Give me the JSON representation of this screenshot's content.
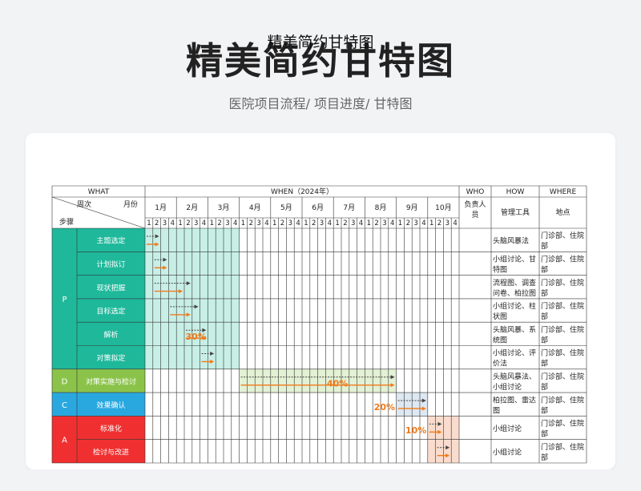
{
  "page": {
    "title": "精美简约甘特图",
    "breadcrumb": "医院项目流程/  项目进度/  甘特图"
  },
  "sheet": {
    "title": "精美简约甘特图",
    "header": {
      "what": "WHAT",
      "when": "WHEN（2024年）",
      "who": "WHO",
      "how": "HOW",
      "where": "WHERE",
      "zhouci": "周次",
      "yuefen": "月份",
      "buzhou": "步骤",
      "responsible": "负责人员",
      "tool": "管理工具",
      "location": "地点"
    },
    "months": [
      "1月",
      "2月",
      "3月",
      "4月",
      "5月",
      "6月",
      "7月",
      "8月",
      "9月",
      "10月"
    ],
    "weeks": [
      "1",
      "2",
      "3",
      "4"
    ],
    "phases": [
      {
        "label": "P",
        "color": "#1fb89b",
        "rows": 6
      },
      {
        "label": "D",
        "color": "#8bc34a",
        "rows": 1
      },
      {
        "label": "C",
        "color": "#29a8e0",
        "rows": 1
      },
      {
        "label": "A",
        "color": "#f03030",
        "rows": 2
      }
    ],
    "tasks": [
      {
        "step": "主题选定",
        "phase": 0,
        "plan": [
          1,
          2
        ],
        "actual": [
          1,
          2
        ],
        "tool": "头脑风暴法",
        "location": "门诊部、住院部"
      },
      {
        "step": "计划拟订",
        "phase": 0,
        "plan": [
          2,
          3
        ],
        "actual": [
          2,
          3
        ],
        "tool": "小组讨论、甘特图",
        "location": "门诊部、住院部"
      },
      {
        "step": "现状把握",
        "phase": 0,
        "plan": [
          2,
          6
        ],
        "actual": [
          2,
          5
        ],
        "tool": "流程图、调查问卷、柏拉图",
        "location": "门诊部、住院部"
      },
      {
        "step": "目标选定",
        "phase": 0,
        "plan": [
          4,
          7
        ],
        "actual": [
          4,
          6
        ],
        "tool": "小组讨论、柱状图",
        "location": "门诊部、住院部"
      },
      {
        "step": "解析",
        "phase": 0,
        "plan": [
          6,
          8
        ],
        "actual": [
          6,
          8
        ],
        "tool": "头脑风暴、系统图",
        "location": "门诊部、住院部"
      },
      {
        "step": "对策拟定",
        "phase": 0,
        "plan": [
          8,
          9
        ],
        "actual": [
          8,
          9
        ],
        "tool": "小组讨论、评价法",
        "location": "门诊部、住院部"
      },
      {
        "step": "对策实施与检讨",
        "phase": 1,
        "plan": [
          13,
          32
        ],
        "actual": [
          13,
          32
        ],
        "tool": "头脑风暴法、小组讨论",
        "location": "门诊部、住院部"
      },
      {
        "step": "效果确认",
        "phase": 2,
        "plan": [
          33,
          36
        ],
        "actual": [
          33,
          36
        ],
        "tool": "柏拉图、雷达图",
        "location": "门诊部、住院部"
      },
      {
        "step": "标准化",
        "phase": 3,
        "plan": [
          37,
          38
        ],
        "actual": [
          37,
          38
        ],
        "tool": "小组讨论",
        "location": "门诊部、住院部"
      },
      {
        "step": "检讨与改进",
        "phase": 3,
        "plan": [
          38,
          39
        ],
        "actual": [
          38,
          39
        ],
        "tool": "小组讨论",
        "location": "门诊部、住院部"
      }
    ],
    "highlights": [
      {
        "from": 1,
        "to": 12,
        "rowFrom": 0,
        "rowTo": 5,
        "color": "#c8efe6"
      },
      {
        "from": 13,
        "to": 32,
        "rowFrom": 6,
        "rowTo": 6,
        "color": "#e3f1d4"
      },
      {
        "from": 33,
        "to": 36,
        "rowFrom": 7,
        "rowTo": 7,
        "color": "#dde8f2"
      },
      {
        "from": 37,
        "to": 40,
        "rowFrom": 8,
        "rowTo": 9,
        "color": "#f9dccd"
      }
    ],
    "percents": [
      {
        "text": "30%",
        "week": 7,
        "row": 4
      },
      {
        "text": "40%",
        "week": 25,
        "row": 6
      },
      {
        "text": "20%",
        "week": 31,
        "row": 7
      },
      {
        "text": "10%",
        "week": 35,
        "row": 8
      }
    ],
    "colors": {
      "grid": "#333333",
      "plan": "#444444",
      "actual": "#f07a1a",
      "percent": "#f07a1a"
    }
  }
}
